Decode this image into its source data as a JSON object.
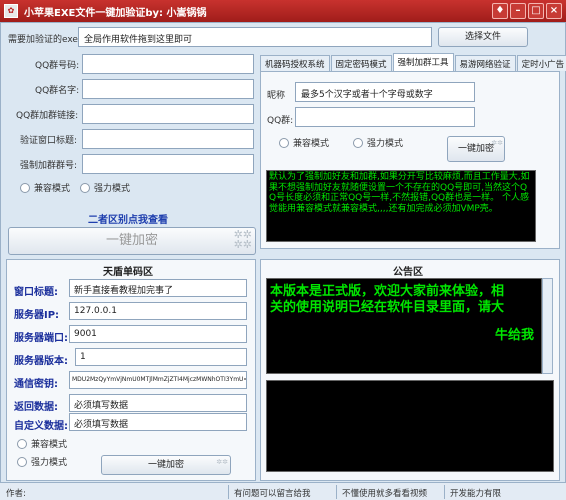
{
  "window": {
    "title": "小苹果EXE文件一键加验证by: 小嵩锅锅",
    "controls": [
      "shirt-icon",
      "minimize",
      "maximize",
      "close"
    ]
  },
  "exe_row": {
    "label": "需要加验证的exe:",
    "value": "全局作用软件拖到这里即可",
    "browse_button": "选择文件"
  },
  "left_form": {
    "fields": [
      {
        "label": "QQ群号码:",
        "value": ""
      },
      {
        "label": "QQ群名字:",
        "value": ""
      },
      {
        "label": "QQ群加群链接:",
        "value": ""
      },
      {
        "label": "验证窗口标题:",
        "value": ""
      },
      {
        "label": "强制加群群号:",
        "value": ""
      }
    ],
    "radio_compat": "兼容模式",
    "radio_force": "强力模式",
    "hint": "二者区别点我查看",
    "big_button": "一键加密"
  },
  "right_tabs": {
    "tabs": [
      "机器码授权系统",
      "固定密码模式",
      "强制加群工具",
      "易游网络验证",
      "定时小广告"
    ],
    "active_index": 2,
    "nick_label": "昵称",
    "nick_value": "最多5个汉字或者十个字母或数字",
    "qq_label": "QQ群:",
    "qq_value": "",
    "radio_compat": "兼容模式",
    "radio_force": "强力模式",
    "button": "一键加密",
    "terminal_text": "默认为了强制加好友和加群,如果分开写比较麻烦,而且工作量大,如果不想强制加好友就随便设置一个不存在的QQ号即可,当然这个QQ号长度必须和正常QQ号一样,不然报错,QQ群也是一样。   个人感觉能用兼容模式就兼容模式,,,,还有加完成必须加VMP壳。"
  },
  "shield_section": {
    "title": "天盾单码区",
    "fields": [
      {
        "label": "窗口标题:",
        "value": "新手直接看教程加完事了"
      },
      {
        "label": "服务器IP:",
        "value": "127.0.0.1"
      },
      {
        "label": "服务器端口:",
        "value": "9001"
      },
      {
        "label": "服务器版本:",
        "value": "1"
      },
      {
        "label": "通信密钥:",
        "value": "MDU2MzQyYmVjNmU0MTJlMmZjZTI4MjczMWNhOTI3YmU="
      },
      {
        "label": "返回数据:",
        "value": "必须填写数据"
      },
      {
        "label": "自定义数据:",
        "value": "必须填写数据"
      }
    ],
    "radio_compat": "兼容模式",
    "radio_force": "强力模式",
    "button": "一键加密"
  },
  "notice": {
    "title": "公告区",
    "text_line1": "本版本是正式版，欢迎大家前来体验，相",
    "text_line2": "关的使用说明已经在软件目录里面，请大",
    "text_line3": "牛给我"
  },
  "statusbar": {
    "author": "作者:",
    "msg1": "有问题可以留言给我",
    "msg2": "不懂使用就多看看视频",
    "msg3": "开发能力有限"
  },
  "colors": {
    "title_bar": "#b82a26",
    "terminal_text": "#00e600",
    "label_blue": "#1b2f9c"
  }
}
